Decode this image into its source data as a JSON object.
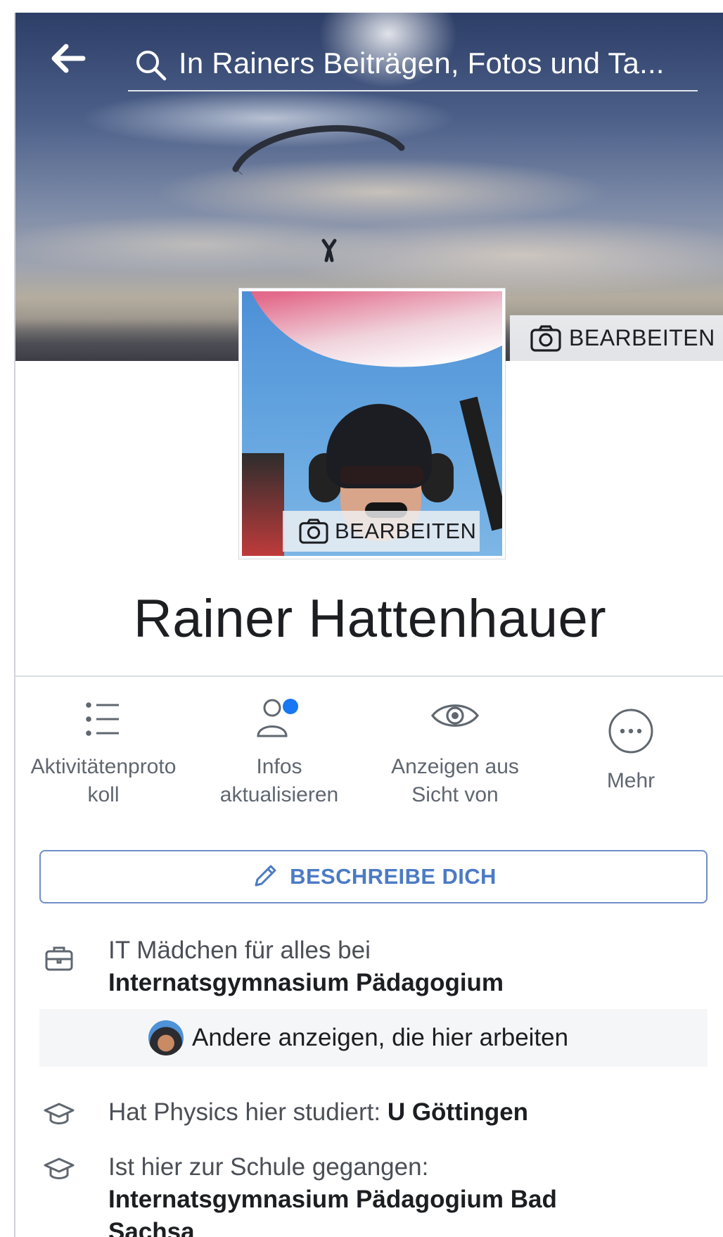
{
  "search": {
    "placeholder": "In Rainers Beiträgen, Fotos und Ta..."
  },
  "cover": {
    "edit_label": "BEARBEITEN"
  },
  "profile_photo": {
    "edit_label": "BEARBEITEN"
  },
  "profile": {
    "name": "Rainer Hattenhauer"
  },
  "actions": [
    {
      "label_line1": "Aktivitätenproto",
      "label_line2": "koll",
      "icon": "list-icon"
    },
    {
      "label_line1": "Infos",
      "label_line2": "aktualisieren",
      "icon": "person-notification-icon"
    },
    {
      "label_line1": "Anzeigen aus",
      "label_line2": "Sicht von",
      "icon": "eye-icon"
    },
    {
      "label_line1": "Mehr",
      "label_line2": "",
      "icon": "more-icon"
    }
  ],
  "describe_button": {
    "label": "BESCHREIBE DICH",
    "icon": "pencil-icon"
  },
  "work": {
    "text": "IT Mädchen für alles bei",
    "employer": "Internatsgymnasium Pädagogium",
    "icon": "briefcase-icon",
    "others_label": "Andere anzeigen, die hier arbeiten"
  },
  "education": [
    {
      "text": "Hat Physics hier studiert: ",
      "school": "U Göttingen",
      "icon": "graduation-cap-icon"
    },
    {
      "text": "Ist hier zur Schule gegangen:",
      "school": "Internatsgymnasium Pädagogium Bad Sachsa",
      "icon": "graduation-cap-icon"
    }
  ],
  "colors": {
    "accent_blue": "#4c7bc4",
    "notification_dot": "#1877f2",
    "secondary_text": "#606770"
  }
}
